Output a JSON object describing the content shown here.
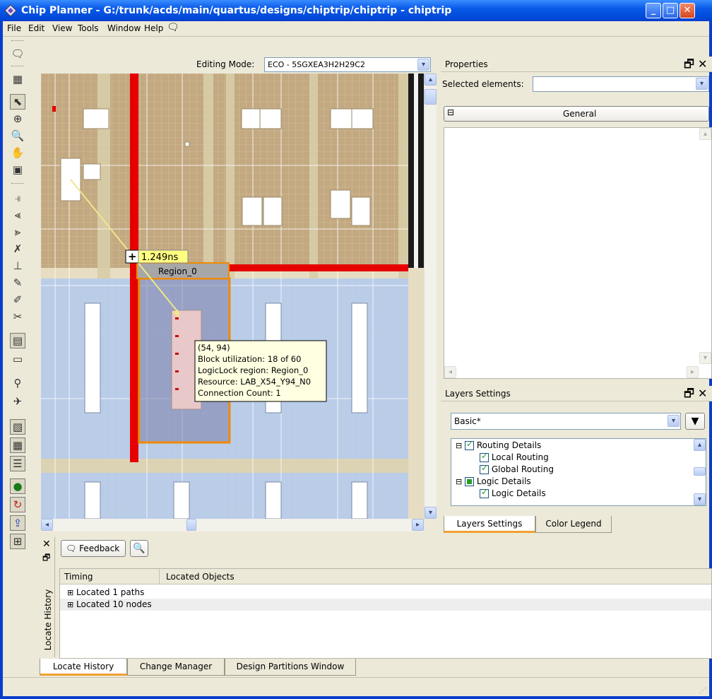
{
  "window": {
    "title": "Chip Planner - G:/trunk/acds/main/quartus/designs/chiptrip/chiptrip - chiptrip",
    "min": "_",
    "max": "□",
    "close": "✕"
  },
  "menu": [
    "File",
    "Edit",
    "View",
    "Tools",
    "Window",
    "Help"
  ],
  "editing": {
    "label": "Editing Mode:",
    "value": "ECO - 5SGXEA3H2H29C2"
  },
  "canvas": {
    "delay_label": "1.249ns",
    "region_label": "Region_0",
    "tooltip": [
      "(54, 94)",
      "Block utilization: 18 of 60",
      "LogicLock region: Region_0",
      "Resource: LAB_X54_Y94_N0",
      "Connection Count: 1"
    ]
  },
  "properties": {
    "title": "Properties",
    "selected_label": "Selected elements:",
    "selected_value": "",
    "group": "General",
    "collapse": "⊟"
  },
  "layers": {
    "title": "Layers Settings",
    "preset": "Basic*",
    "tree": [
      {
        "label": "Routing Details",
        "state": "on",
        "level": 0,
        "exp": "⊟"
      },
      {
        "label": "Local Routing",
        "state": "on",
        "level": 1
      },
      {
        "label": "Global Routing",
        "state": "on",
        "level": 1
      },
      {
        "label": "Logic Details",
        "state": "part",
        "level": 0,
        "exp": "⊟"
      },
      {
        "label": "Logic Details",
        "state": "on",
        "level": 1
      }
    ],
    "tabs": [
      "Layers Settings",
      "Color Legend"
    ]
  },
  "bottom": {
    "feedback": "Feedback",
    "columns": [
      "Timing",
      "Located Objects"
    ],
    "rows": [
      "Located 1 paths",
      "Located 10 nodes"
    ],
    "side_label": "Locate History",
    "tabs": [
      "Locate History",
      "Change Manager",
      "Design Partitions Window"
    ]
  },
  "colors": {
    "title": "#0a5ae8",
    "routing_red": "#e60000",
    "region_orange": "#f08a00",
    "lab_blue": "#b9cce8",
    "tooltip_bg": "#ffffe1"
  }
}
